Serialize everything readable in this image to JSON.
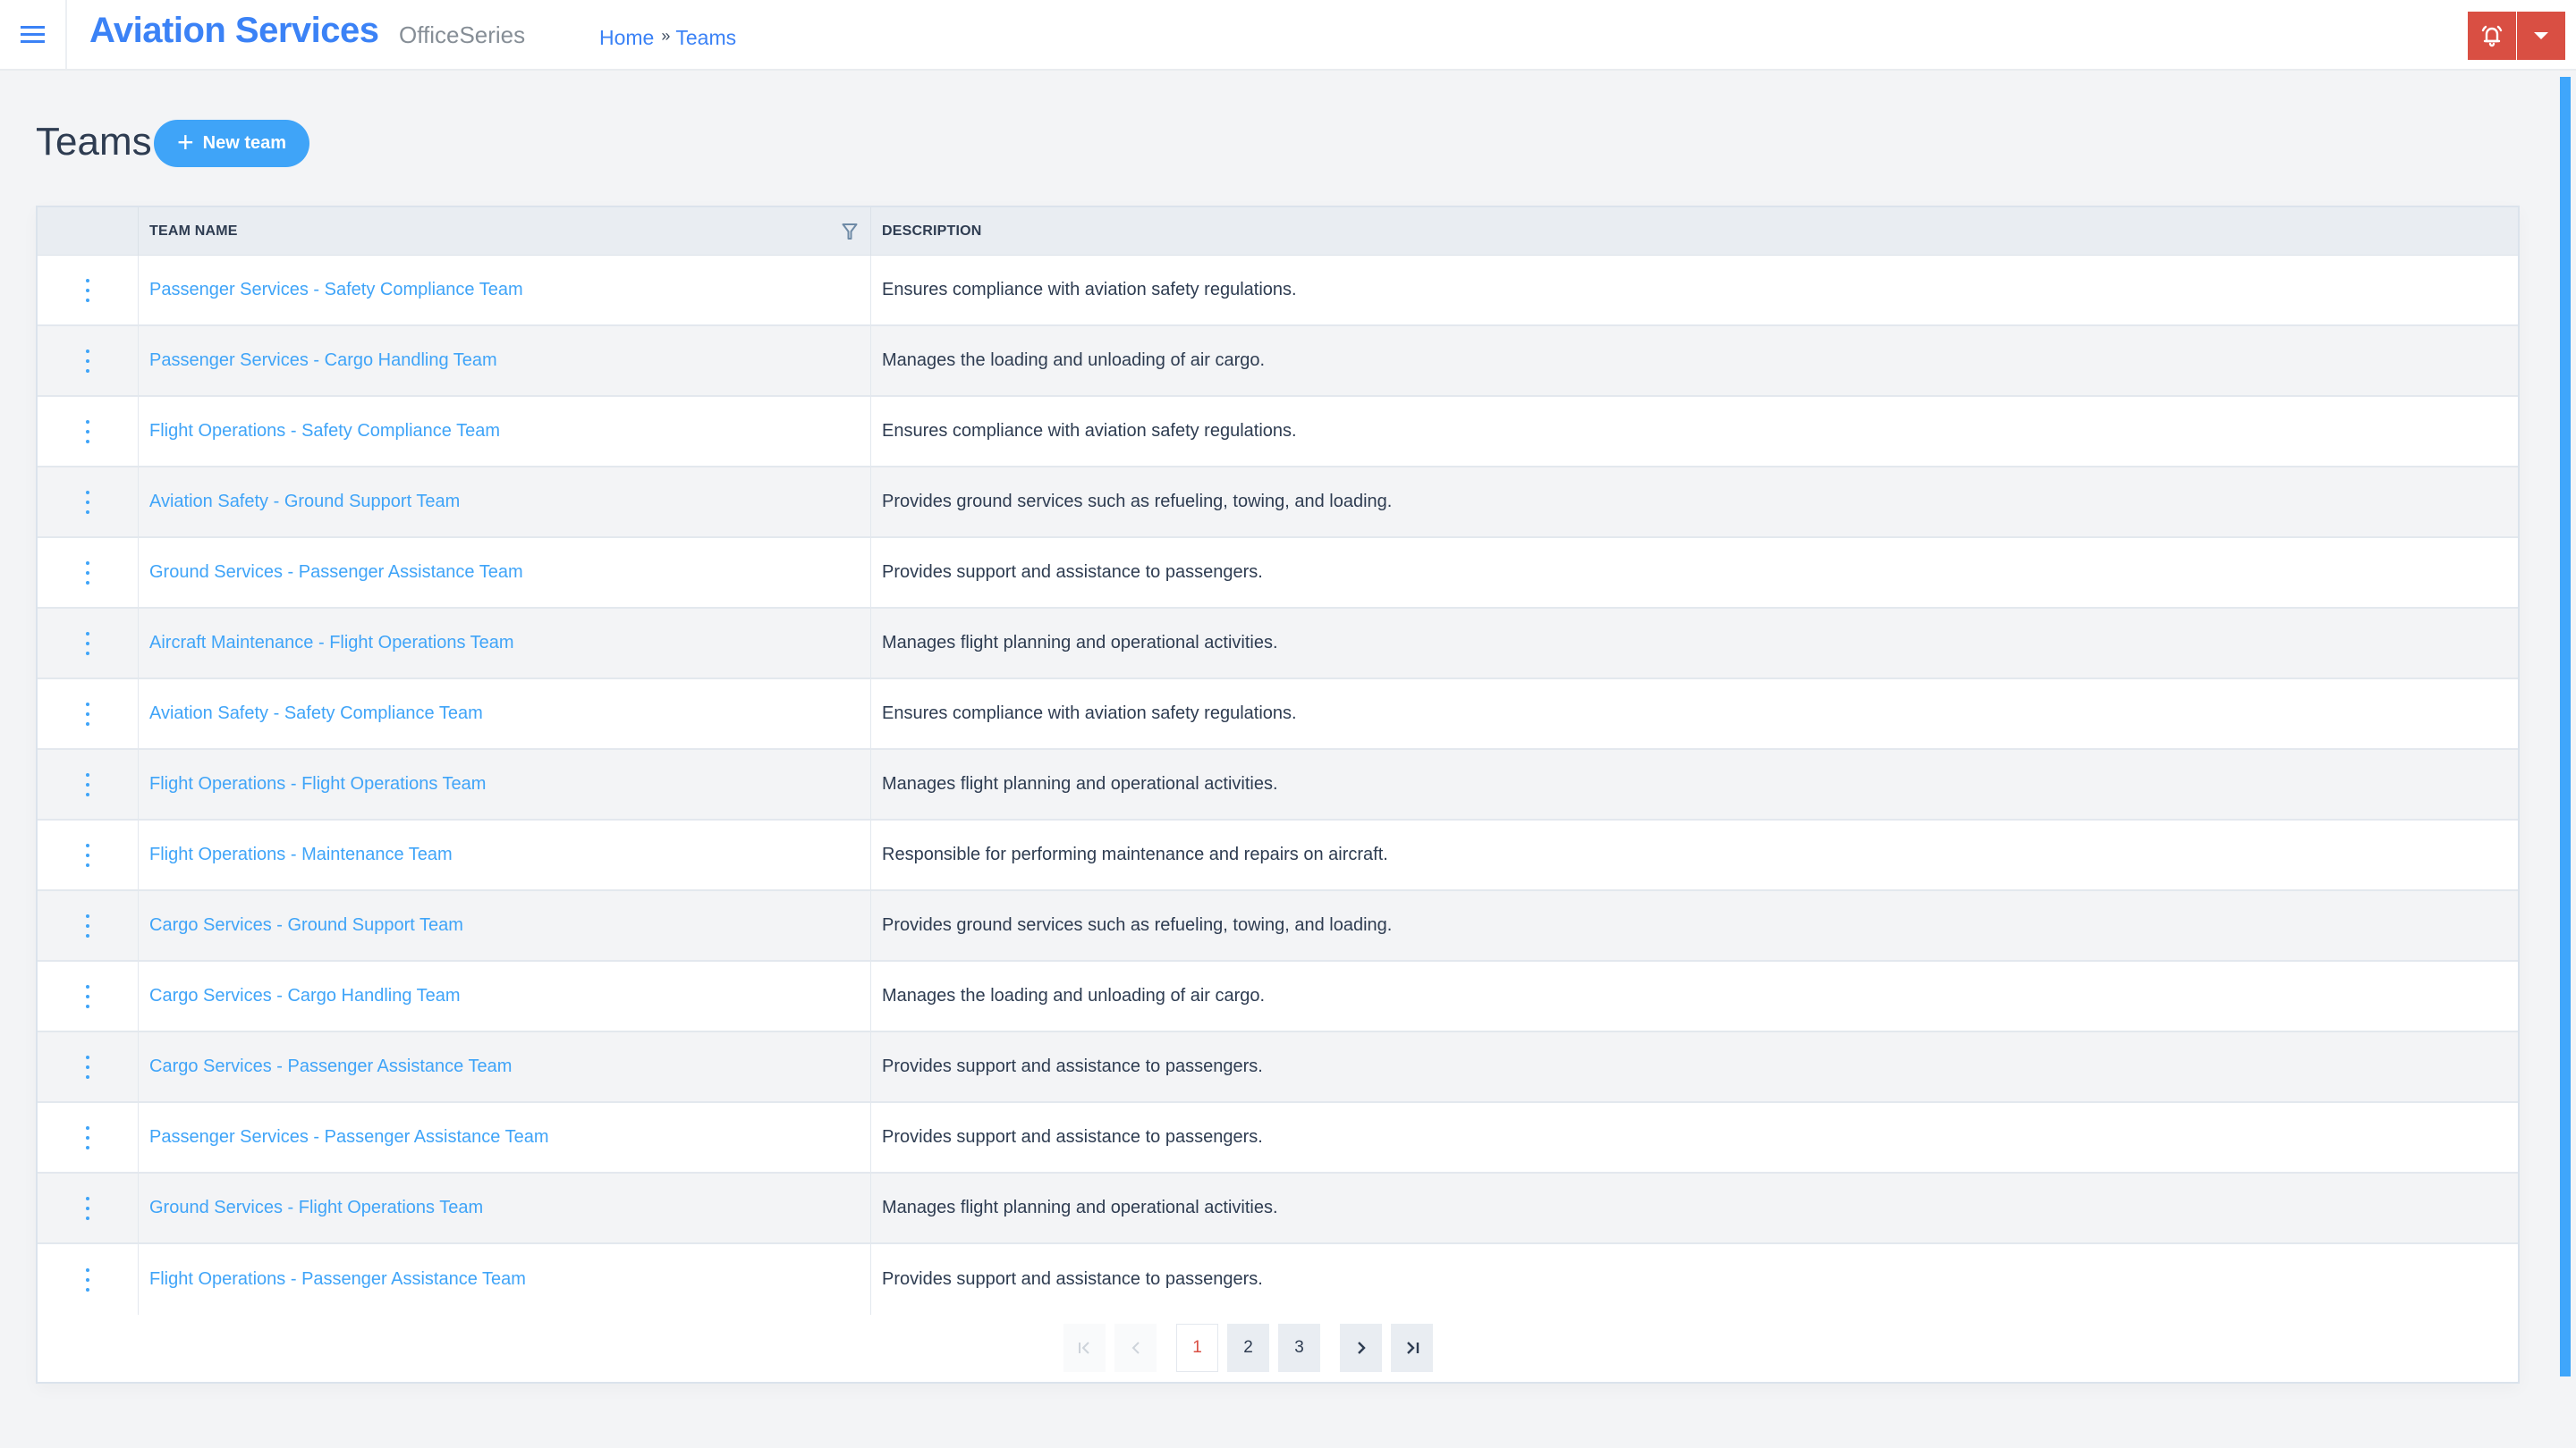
{
  "header": {
    "app_title": "Aviation Services",
    "app_subtitle": "OfficeSeries",
    "breadcrumb": [
      {
        "label": "Home"
      },
      {
        "label": "Teams"
      }
    ],
    "breadcrumb_separator": "»",
    "icons": {
      "menu": "hamburger-menu-icon",
      "alert": "bell-alert-icon",
      "dropdown": "caret-down-icon"
    },
    "colors": {
      "brand": "#3b82f6",
      "alert": "#d94f43",
      "accent": "#3fa4f8"
    }
  },
  "page": {
    "title": "Teams",
    "new_button_label": "New team",
    "new_button_icon": "plus-icon"
  },
  "table": {
    "columns": [
      {
        "key": "actions",
        "label": ""
      },
      {
        "key": "name",
        "label": "TEAM NAME",
        "filter_icon": "filter-icon"
      },
      {
        "key": "description",
        "label": "DESCRIPTION"
      }
    ],
    "rows": [
      {
        "name": "Passenger Services - Safety Compliance Team",
        "description": "Ensures compliance with aviation safety regulations."
      },
      {
        "name": "Passenger Services - Cargo Handling Team",
        "description": "Manages the loading and unloading of air cargo."
      },
      {
        "name": "Flight Operations - Safety Compliance Team",
        "description": "Ensures compliance with aviation safety regulations."
      },
      {
        "name": "Aviation Safety - Ground Support Team",
        "description": "Provides ground services such as refueling, towing, and loading."
      },
      {
        "name": "Ground Services - Passenger Assistance Team",
        "description": "Provides support and assistance to passengers."
      },
      {
        "name": "Aircraft Maintenance - Flight Operations Team",
        "description": "Manages flight planning and operational activities."
      },
      {
        "name": "Aviation Safety - Safety Compliance Team",
        "description": "Ensures compliance with aviation safety regulations."
      },
      {
        "name": "Flight Operations - Flight Operations Team",
        "description": "Manages flight planning and operational activities."
      },
      {
        "name": "Flight Operations - Maintenance Team",
        "description": "Responsible for performing maintenance and repairs on aircraft."
      },
      {
        "name": "Cargo Services - Ground Support Team",
        "description": "Provides ground services such as refueling, towing, and loading."
      },
      {
        "name": "Cargo Services - Cargo Handling Team",
        "description": "Manages the loading and unloading of air cargo."
      },
      {
        "name": "Cargo Services - Passenger Assistance Team",
        "description": "Provides support and assistance to passengers."
      },
      {
        "name": "Passenger Services - Passenger Assistance Team",
        "description": "Provides support and assistance to passengers."
      },
      {
        "name": "Ground Services - Flight Operations Team",
        "description": "Manages flight planning and operational activities."
      },
      {
        "name": "Flight Operations - Passenger Assistance Team",
        "description": "Provides support and assistance to passengers."
      }
    ],
    "row_action_icon": "kebab-menu-icon"
  },
  "pagination": {
    "current_page": 1,
    "pages": [
      "1",
      "2",
      "3"
    ],
    "first_icon": "first-page-icon",
    "prev_icon": "prev-page-icon",
    "next_icon": "next-page-icon",
    "last_icon": "last-page-icon"
  }
}
